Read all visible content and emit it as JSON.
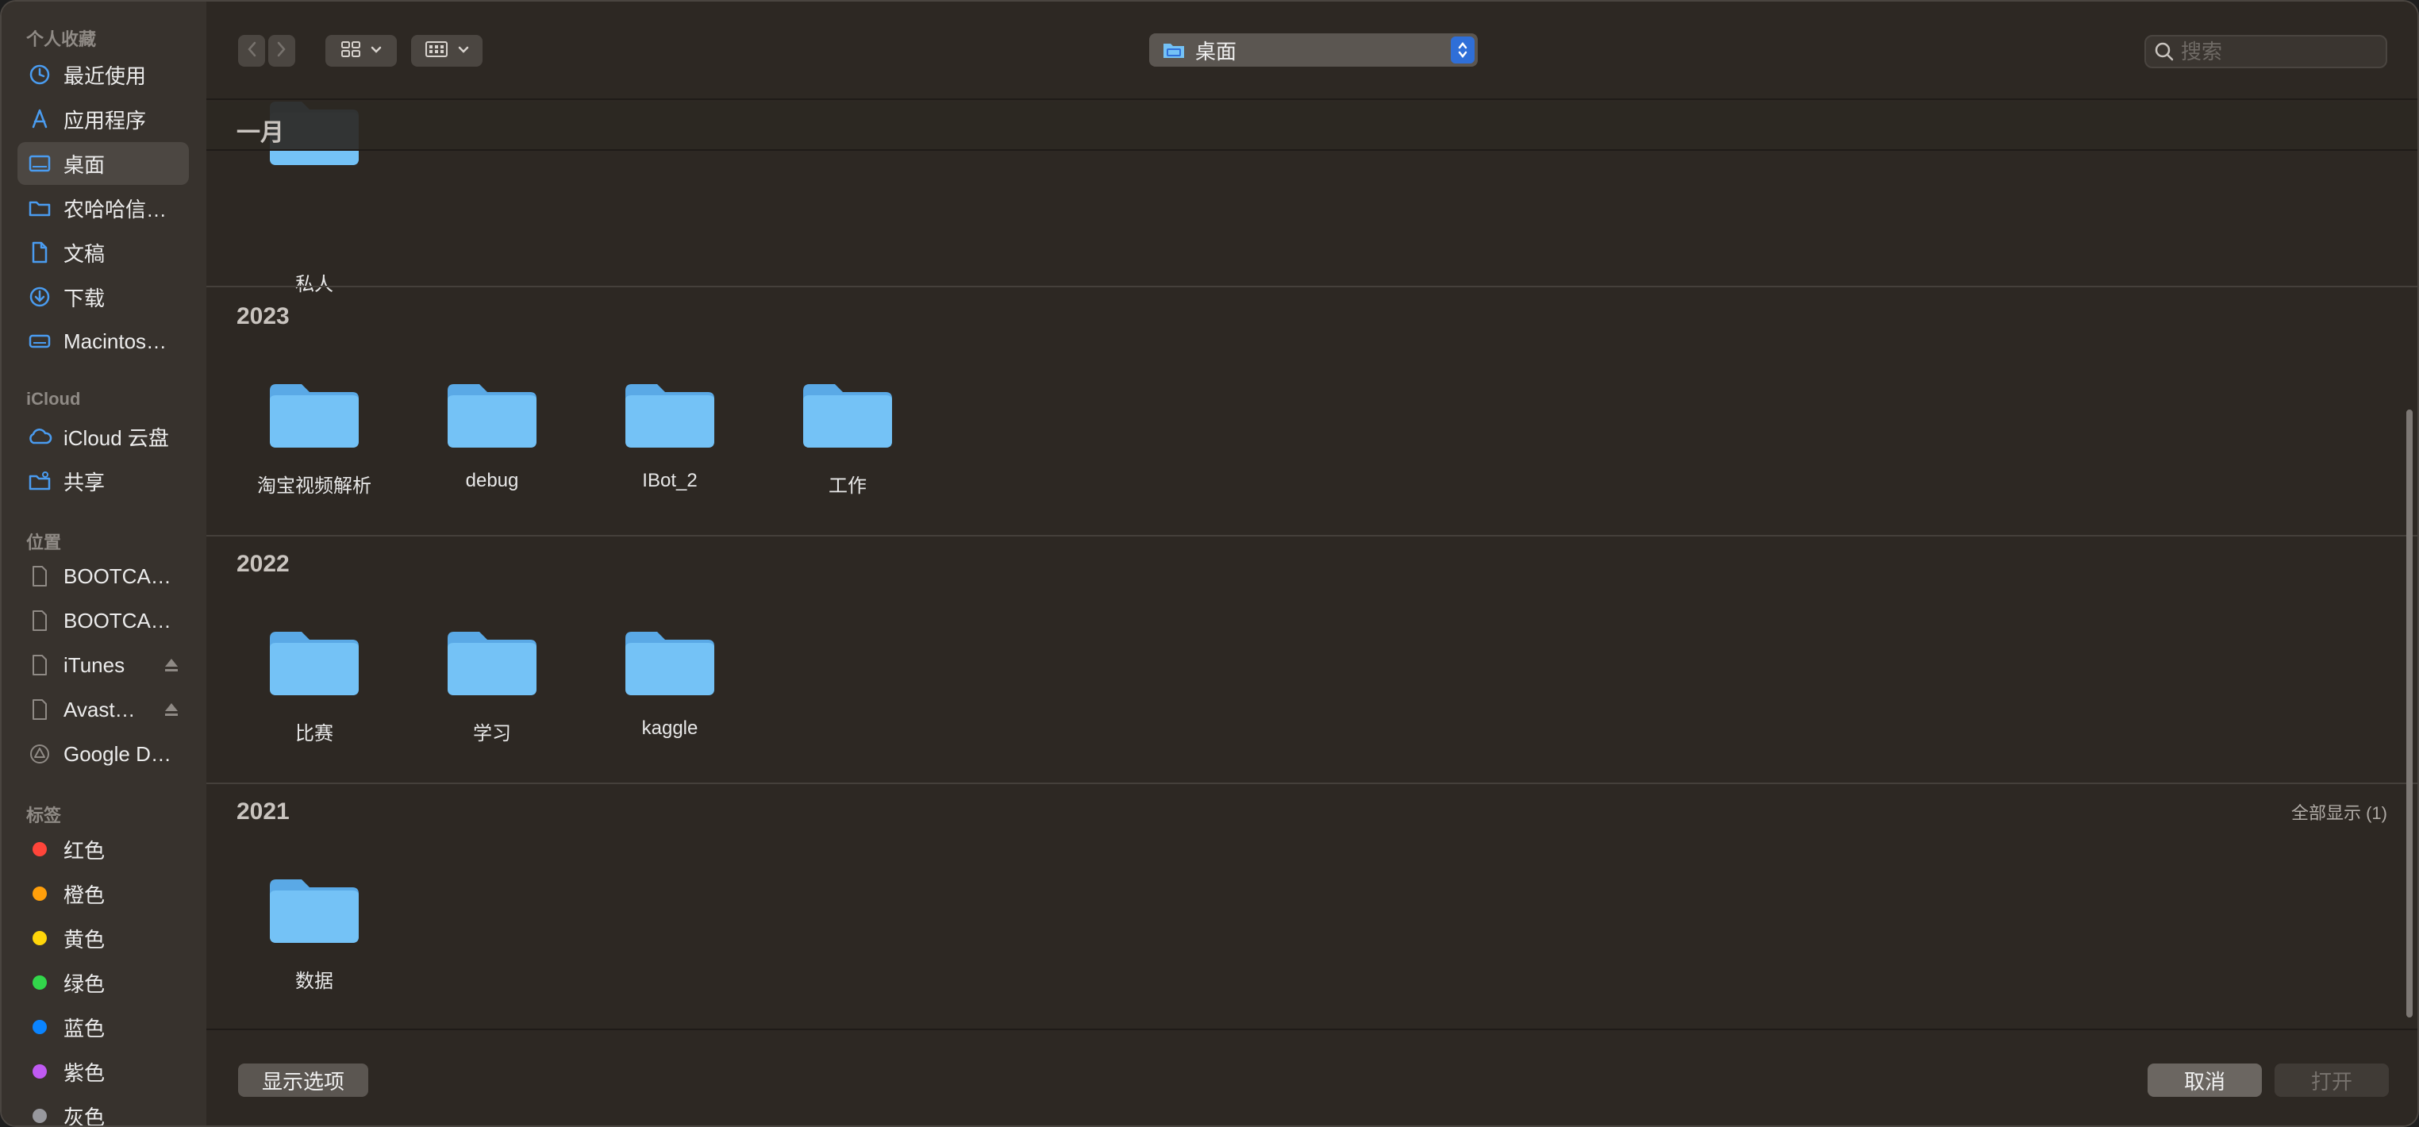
{
  "sidebar": {
    "sections": {
      "favorites": "个人收藏",
      "icloud": "iCloud",
      "locations": "位置",
      "tags": "标签"
    },
    "favorites": [
      {
        "label": "最近使用",
        "icon": "clock-icon"
      },
      {
        "label": "应用程序",
        "icon": "applications-icon"
      },
      {
        "label": "桌面",
        "icon": "desktop-icon",
        "selected": true
      },
      {
        "label": "农哈哈信…",
        "icon": "folder-icon"
      },
      {
        "label": "文稿",
        "icon": "document-icon"
      },
      {
        "label": "下载",
        "icon": "download-icon"
      },
      {
        "label": "Macintos…",
        "icon": "disk-icon"
      }
    ],
    "icloud": [
      {
        "label": "iCloud 云盘",
        "icon": "cloud-icon"
      },
      {
        "label": "共享",
        "icon": "shared-folder-icon"
      }
    ],
    "locations": [
      {
        "label": "BOOTCA…",
        "icon": "file-icon"
      },
      {
        "label": "BOOTCA…",
        "icon": "file-icon"
      },
      {
        "label": "iTunes",
        "icon": "file-icon",
        "eject": true
      },
      {
        "label": "Avast…",
        "icon": "file-icon",
        "eject": true
      },
      {
        "label": "Google D…",
        "icon": "google-drive-icon"
      }
    ],
    "tags": [
      {
        "label": "红色",
        "color": "#ff453a"
      },
      {
        "label": "橙色",
        "color": "#ff9f0a"
      },
      {
        "label": "黄色",
        "color": "#ffd60a"
      },
      {
        "label": "绿色",
        "color": "#32d74b"
      },
      {
        "label": "蓝色",
        "color": "#0a84ff"
      },
      {
        "label": "紫色",
        "color": "#bf5af2"
      },
      {
        "label": "灰色",
        "color": "#98989d"
      }
    ]
  },
  "toolbar": {
    "location": "桌面",
    "search_placeholder": "搜索"
  },
  "content": {
    "sticky_group": "一月",
    "groups": [
      {
        "title": "一月",
        "items": [
          "私人"
        ]
      },
      {
        "title": "2023",
        "items": [
          "淘宝视频解析",
          "debug",
          "IBot_2",
          "工作"
        ]
      },
      {
        "title": "2022",
        "items": [
          "比赛",
          "学习",
          "kaggle"
        ]
      },
      {
        "title": "2021",
        "items": [
          "数据"
        ],
        "show_all": "全部显示 (1)"
      }
    ]
  },
  "bottom": {
    "options_label": "显示选项",
    "cancel_label": "取消",
    "open_label": "打开"
  },
  "colors": {
    "accent": "#2f6fd8",
    "folder": "#74c2f6",
    "folder_dark": "#5aa9e6"
  }
}
